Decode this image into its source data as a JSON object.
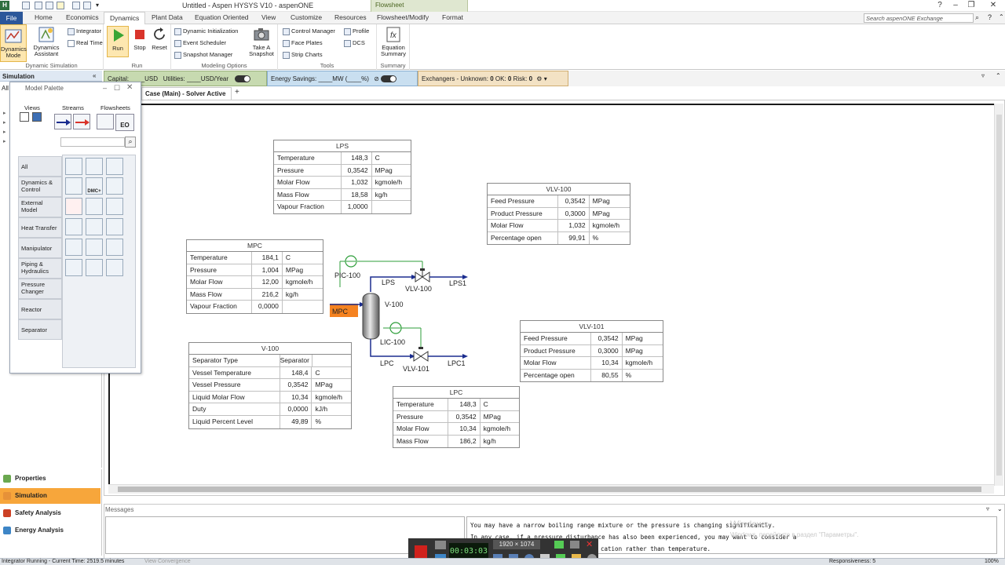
{
  "window": {
    "title": "Untitled - Aspen HYSYS V10 - aspenONE",
    "context_tab": "Flowsheet",
    "controls": [
      "?",
      "–",
      "❐",
      "✕"
    ]
  },
  "ribbon_tabs": [
    "File",
    "Home",
    "Economics",
    "Dynamics",
    "Plant Data",
    "Equation Oriented",
    "View",
    "Customize",
    "Resources",
    "Flowsheet/Modify",
    "Format"
  ],
  "active_tab": "Dynamics",
  "search": {
    "placeholder": "Search aspenONE Exchange"
  },
  "ribbon": {
    "dynamic_simulation": {
      "label": "Dynamic Simulation",
      "dynamics_mode": "Dynamics Mode",
      "dynamics_assistant": "Dynamics Assistant",
      "integrator": "Integrator",
      "real_time": "Real Time"
    },
    "run": {
      "label": "Run",
      "run": "Run",
      "stop": "Stop",
      "reset": "Reset"
    },
    "modeling_options": {
      "label": "Modeling Options",
      "dynamic_initialization": "Dynamic Initialization",
      "event_scheduler": "Event Scheduler",
      "snapshot_manager": "Snapshot Manager",
      "take_snapshot": "Take A Snapshot"
    },
    "tools": {
      "label": "Tools",
      "control_manager": "Control Manager",
      "face_plates": "Face Plates",
      "strip_charts": "Strip Charts",
      "profile": "Profile",
      "dcs": "DCS"
    },
    "summary": {
      "label": "Summary",
      "equation_summary": "Equation Summary"
    }
  },
  "left": {
    "header": "Simulation",
    "all_label": "All",
    "nav": [
      {
        "label": "Properties",
        "color": "#6aa84f"
      },
      {
        "label": "Simulation",
        "color": "#e69138"
      },
      {
        "label": "Safety Analysis",
        "color": "#cc4125"
      },
      {
        "label": "Energy Analysis",
        "color": "#3d85c6"
      }
    ]
  },
  "palette": {
    "title": "Model Palette",
    "headers": {
      "views": "Views",
      "streams": "Streams",
      "flowsheets": "Flowsheets"
    },
    "categories": [
      "All",
      "Dynamics & Control",
      "External Model",
      "Heat Transfer",
      "Manipulator",
      "Piping & Hydraulics",
      "Pressure Changer",
      "Reactor",
      "Separator"
    ],
    "eo_label": "EO",
    "dmc_label": "DMC+"
  },
  "strip": {
    "capital": "Capital: ____USD",
    "utilities": "Utilities: ____USD/Year",
    "energy": "Energy Savings: ____MW  (____%)",
    "exchangers": "Exchangers -",
    "unknown_label": "Unknown:",
    "unknown_val": "0",
    "ok_label": "OK:",
    "ok_val": "0",
    "risk_label": "Risk:",
    "risk_val": "0"
  },
  "doc_tab": {
    "label": "Case (Main) - Solver Active"
  },
  "flowsheet": {
    "labels": {
      "pic": "PIC-100",
      "lps": "LPS",
      "vlv100": "VLV-100",
      "lps1": "LPS1",
      "mpc": "MPC",
      "v100": "V-100",
      "lic": "LIC-100",
      "lpc": "LPC",
      "vlv101": "VLV-101",
      "lpc1": "LPC1"
    },
    "tables": {
      "lps": {
        "title": "LPS",
        "rows": [
          [
            "Temperature",
            "148,3",
            "C"
          ],
          [
            "Pressure",
            "0,3542",
            "MPag"
          ],
          [
            "Molar Flow",
            "1,032",
            "kgmole/h"
          ],
          [
            "Mass Flow",
            "18,58",
            "kg/h"
          ],
          [
            "Vapour Fraction",
            "1,0000",
            ""
          ]
        ]
      },
      "vlv100": {
        "title": "VLV-100",
        "rows": [
          [
            "Feed Pressure",
            "0,3542",
            "MPag"
          ],
          [
            "Product Pressure",
            "0,3000",
            "MPag"
          ],
          [
            "Molar Flow",
            "1,032",
            "kgmole/h"
          ],
          [
            "Percentage open",
            "99,91",
            "%"
          ]
        ]
      },
      "mpc": {
        "title": "MPC",
        "rows": [
          [
            "Temperature",
            "184,1",
            "C"
          ],
          [
            "Pressure",
            "1,004",
            "MPag"
          ],
          [
            "Molar Flow",
            "12,00",
            "kgmole/h"
          ],
          [
            "Mass Flow",
            "216,2",
            "kg/h"
          ],
          [
            "Vapour Fraction",
            "0,0000",
            ""
          ]
        ]
      },
      "vlv101": {
        "title": "VLV-101",
        "rows": [
          [
            "Feed Pressure",
            "0,3542",
            "MPag"
          ],
          [
            "Product Pressure",
            "0,3000",
            "MPag"
          ],
          [
            "Molar Flow",
            "10,34",
            "kgmole/h"
          ],
          [
            "Percentage open",
            "80,55",
            "%"
          ]
        ]
      },
      "v100": {
        "title": "V-100",
        "rows": [
          [
            "Separator Type",
            "Separator",
            ""
          ],
          [
            "Vessel Temperature",
            "148,4",
            "C"
          ],
          [
            "Vessel Pressure",
            "0,3542",
            "MPag"
          ],
          [
            "Liquid Molar Flow",
            "10,34",
            "kgmole/h"
          ],
          [
            "Duty",
            "0,0000",
            "kJ/h"
          ],
          [
            "Liquid Percent Level",
            "49,89",
            "%"
          ]
        ]
      },
      "lpc": {
        "title": "LPC",
        "rows": [
          [
            "Temperature",
            "148,3",
            "C"
          ],
          [
            "Pressure",
            "0,3542",
            "MPag"
          ],
          [
            "Molar Flow",
            "10,34",
            "kgmole/h"
          ],
          [
            "Mass Flow",
            "186,2",
            "kg/h"
          ]
        ]
      }
    }
  },
  "messages": {
    "title": "Messages",
    "lines": [
      "You may have a narrow boiling range mixture or the pressure is changing significantly.",
      "In any case, if a pressure disturbance has also been experienced, you may want to consider a",
      "cation rather than temperature."
    ]
  },
  "watermark": {
    "line1": "Windows",
    "line2": "Windows, перейдите в раздел \"Параметры\"."
  },
  "recorder": {
    "time": "00:03:03",
    "resolution": "1920 × 1074"
  },
  "statusbar": {
    "left": "Integrator Running - Current Time: 2519.5 minutes",
    "view_convergence": "View Convergence",
    "responsiveness": "Responsiveness: 5",
    "zoom": "100%"
  }
}
